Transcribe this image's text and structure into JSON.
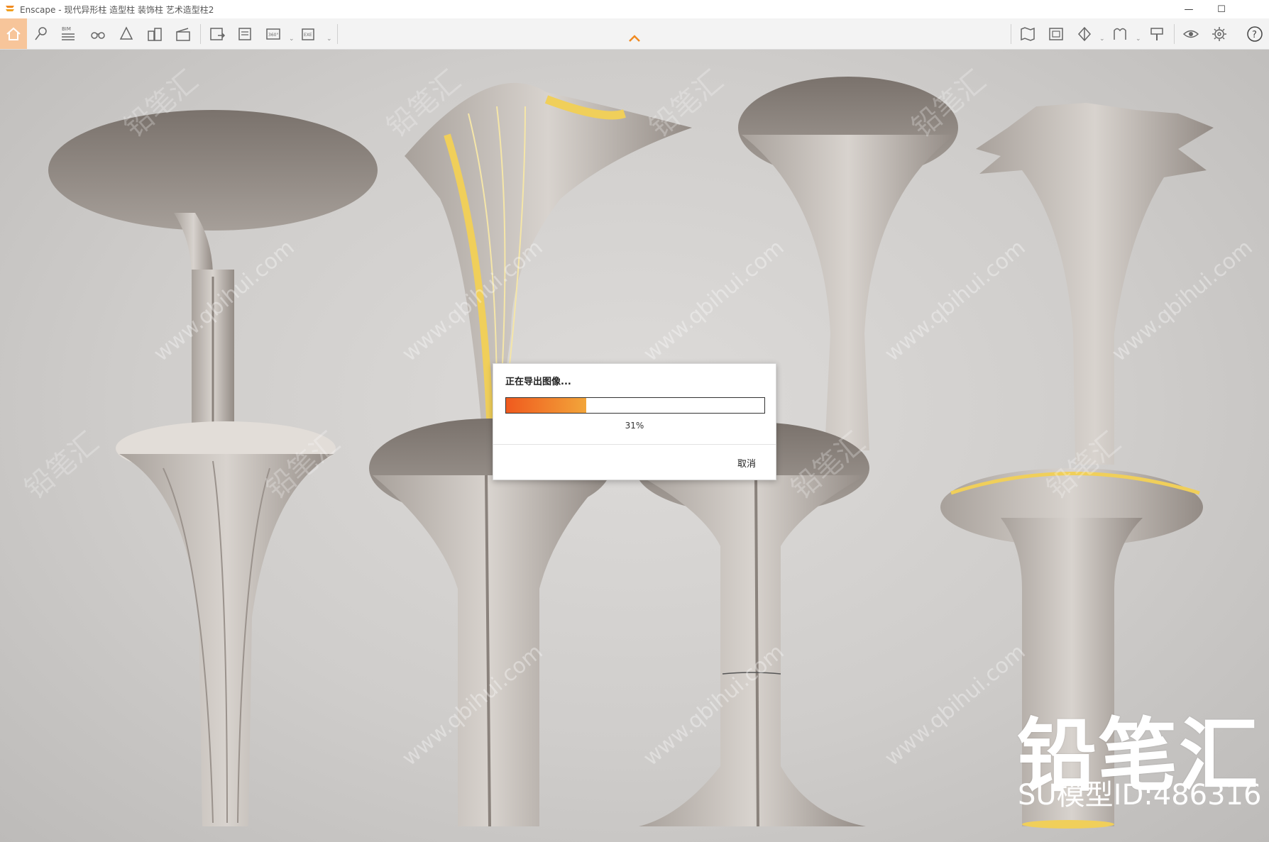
{
  "window": {
    "app_name": "Enscape",
    "title": "Enscape - 现代异形柱 造型柱 装饰柱 艺术造型柱2",
    "controls": [
      "minimize",
      "maximize"
    ]
  },
  "toolbar": {
    "left_icons": [
      "home-icon",
      "pin-icon",
      "bim-icon",
      "binoculars-icon",
      "bell-icon",
      "buildings-icon",
      "clapboard-icon",
      "export-image-icon",
      "batch-export-icon",
      "360-export-icon",
      "exe-export-icon"
    ],
    "bim_label": "BIM",
    "pano_label": "360°",
    "exe_label": "EXE",
    "right_icons": [
      "map-icon",
      "asset-library-icon",
      "view-cube-icon",
      "material-icon",
      "paint-icon",
      "visual-settings-icon",
      "settings-gear-icon",
      "help-icon"
    ]
  },
  "dialog": {
    "title": "正在导出图像...",
    "progress": 0.31,
    "progress_text": "31%",
    "cancel_label": "取消",
    "fill_start": "#f05a1e",
    "fill_end": "#f2a53a"
  },
  "watermark": {
    "url_text": "www.qbihui.com",
    "cn_text": "铅笔汇",
    "brand": "铅笔汇",
    "model_id": "SU模型ID:486316"
  },
  "colors": {
    "accent": "#f7c59a",
    "column": "#8f8781",
    "gold": "#f0cf5a"
  }
}
